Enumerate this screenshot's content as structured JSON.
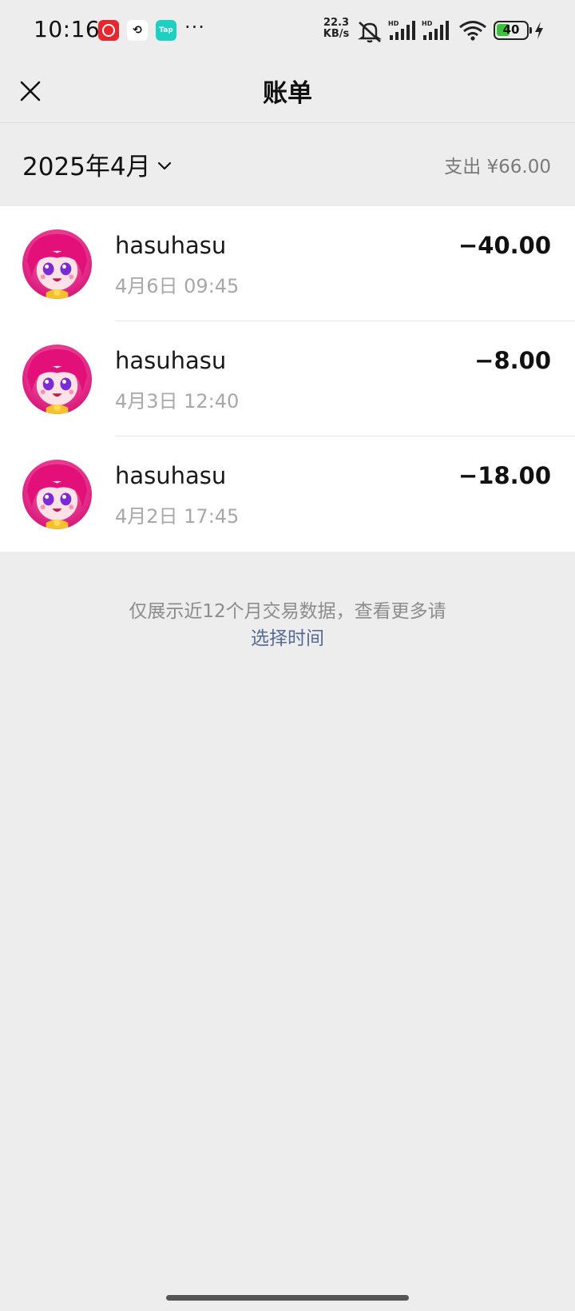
{
  "status_bar": {
    "time": "10:16",
    "dots": "···",
    "net_speed_value": "22.3",
    "net_speed_unit": "KB/s",
    "battery_level": "40",
    "apps": [
      "netease-music-icon",
      "link-app-icon",
      "taptap-icon"
    ],
    "tap_label": "Tap"
  },
  "nav": {
    "title": "账单",
    "close_icon": "close-icon"
  },
  "month_header": {
    "month": "2025年4月",
    "expense_total": "支出 ¥66.00"
  },
  "transactions": [
    {
      "name": "hasuhasu",
      "time": "4月6日 09:45",
      "amount": "−40.00"
    },
    {
      "name": "hasuhasu",
      "time": "4月3日 12:40",
      "amount": "−8.00"
    },
    {
      "name": "hasuhasu",
      "time": "4月2日 17:45",
      "amount": "−18.00"
    }
  ],
  "footer": {
    "note": "仅展示近12个月交易数据，查看更多请",
    "link": "选择时间"
  },
  "colors": {
    "background": "#ededed",
    "list_background": "#ffffff",
    "link": "#576b95",
    "muted_text": "#a8a8a8"
  }
}
